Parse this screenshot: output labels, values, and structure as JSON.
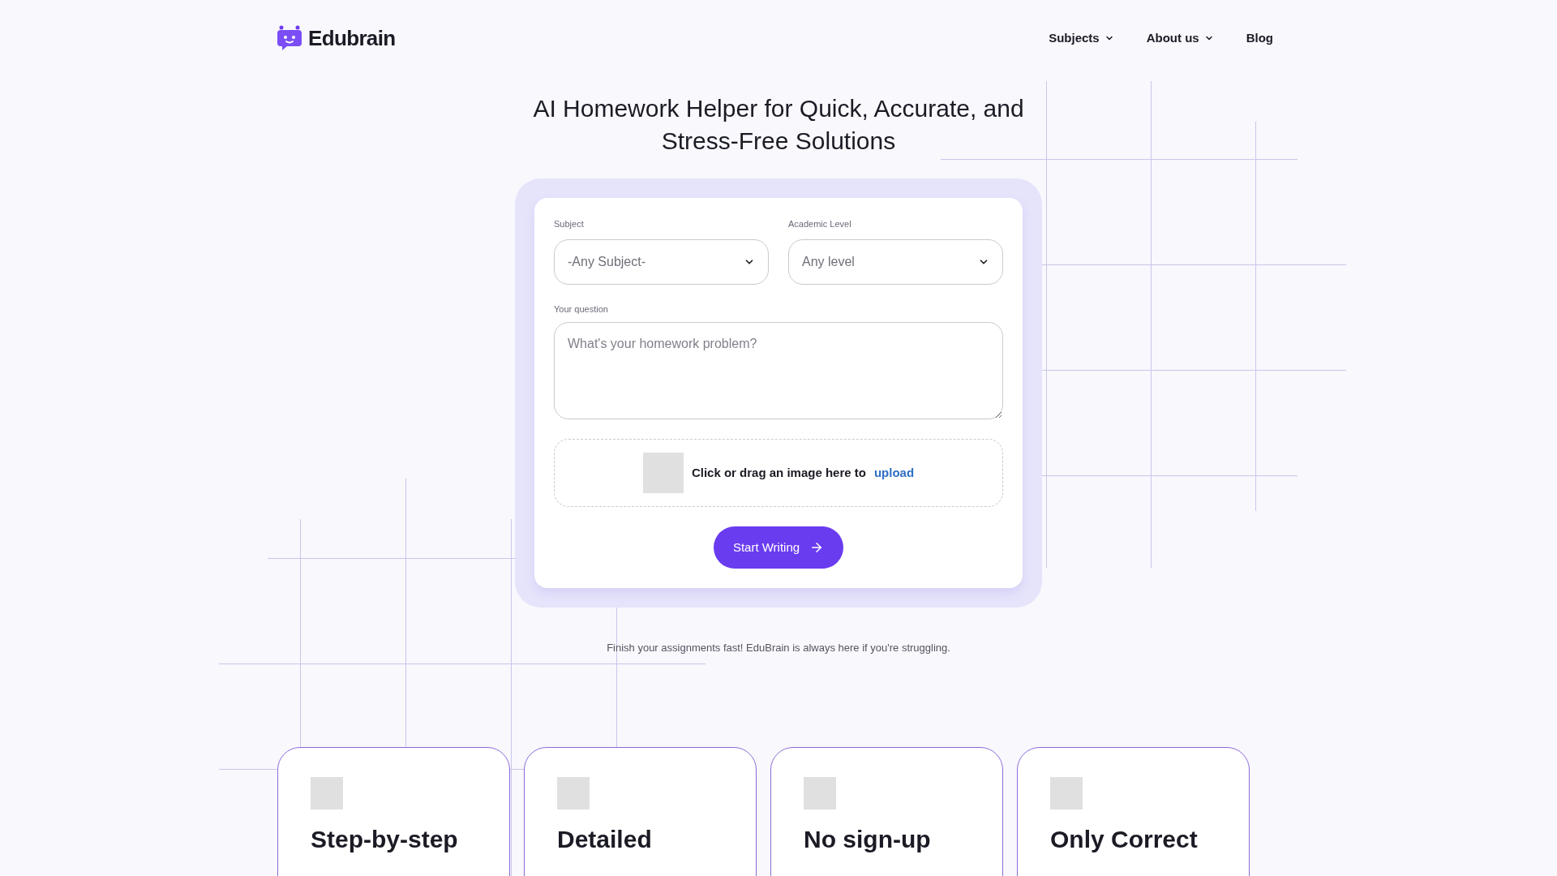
{
  "header": {
    "logo": "Edubrain",
    "nav": [
      {
        "label": "Subjects",
        "kind": "dropdown"
      },
      {
        "label": "About us",
        "kind": "dropdown"
      },
      {
        "label": "Blog",
        "kind": "link"
      }
    ]
  },
  "hero": {
    "title": "AI Homework Helper for Quick, Accurate, and Stress-Free Solutions"
  },
  "form": {
    "subject": {
      "label": "Subject",
      "value": "-Any Subject-"
    },
    "level": {
      "label": "Academic Level",
      "value": "Any level"
    },
    "question": {
      "label": "Your question",
      "placeholder": "What's your homework problem?"
    },
    "upload": {
      "text": "Click or drag an image here to",
      "link": "upload"
    },
    "button": "Start Writing"
  },
  "tagline": "Finish your assignments fast! EduBrain is always here if you're struggling.",
  "features": [
    {
      "title": "Step-by-step"
    },
    {
      "title": "Detailed"
    },
    {
      "title": "No sign-up"
    },
    {
      "title": "Only Correct"
    }
  ]
}
